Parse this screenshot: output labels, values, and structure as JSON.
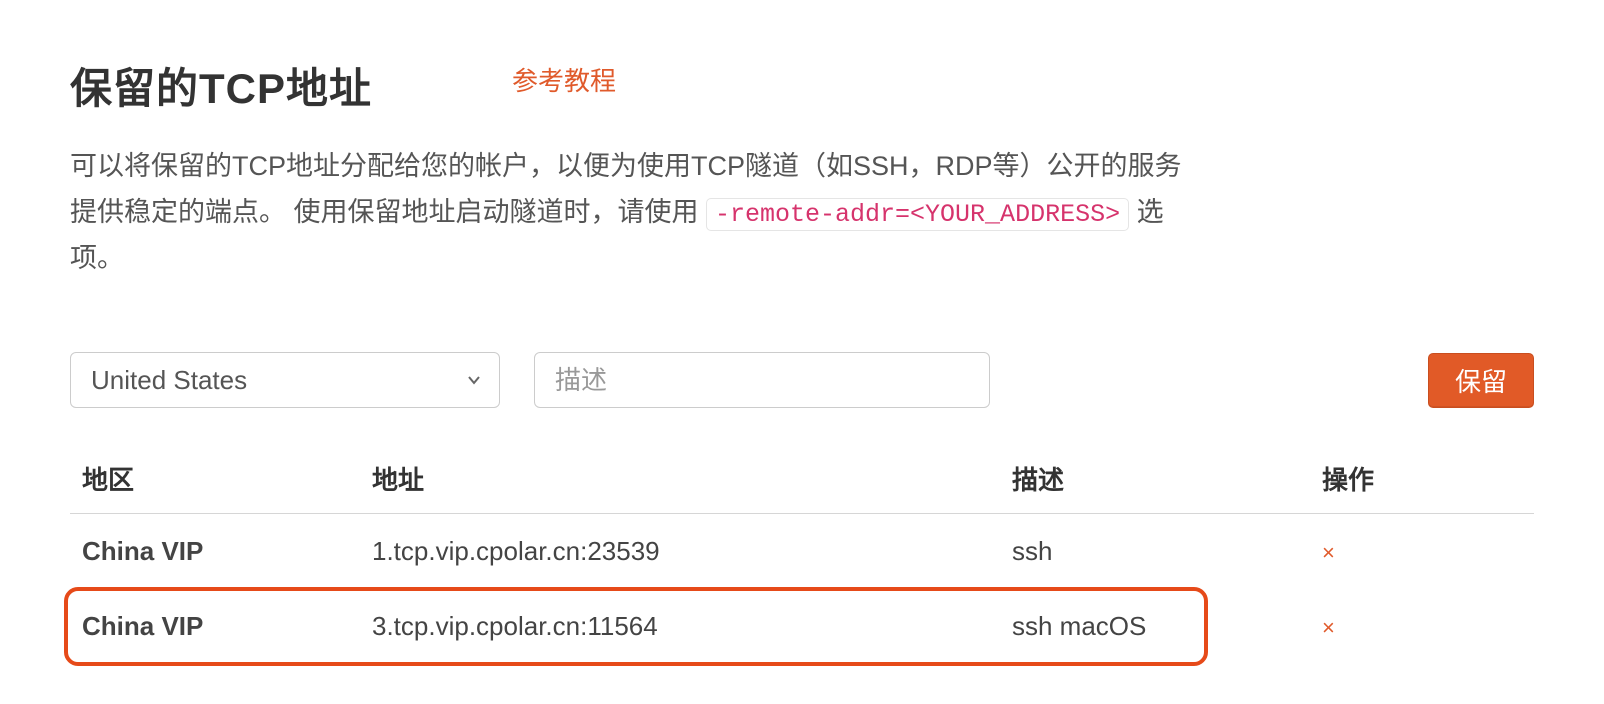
{
  "header": {
    "title": "保留的TCP地址",
    "tutorial_link_text": "参考教程"
  },
  "description": {
    "part1": "可以将保留的TCP地址分配给您的帐户，以便为使用TCP隧道（如SSH，RDP等）公开的服务提供稳定的端点。 使用保留地址启动隧道时，请使用 ",
    "code": "-remote-addr=<YOUR_ADDRESS>",
    "part2": " 选项。"
  },
  "form": {
    "region_selected": "United States",
    "desc_placeholder": "描述",
    "reserve_button_label": "保留"
  },
  "table": {
    "headers": {
      "region": "地区",
      "address": "地址",
      "description": "描述",
      "action": "操作"
    },
    "rows": [
      {
        "region": "China VIP",
        "address": "1.tcp.vip.cpolar.cn:23539",
        "description": "ssh",
        "delete_label": "×",
        "highlight": false
      },
      {
        "region": "China VIP",
        "address": "3.tcp.vip.cpolar.cn:11564",
        "description": "ssh macOS",
        "delete_label": "×",
        "highlight": true
      }
    ]
  }
}
